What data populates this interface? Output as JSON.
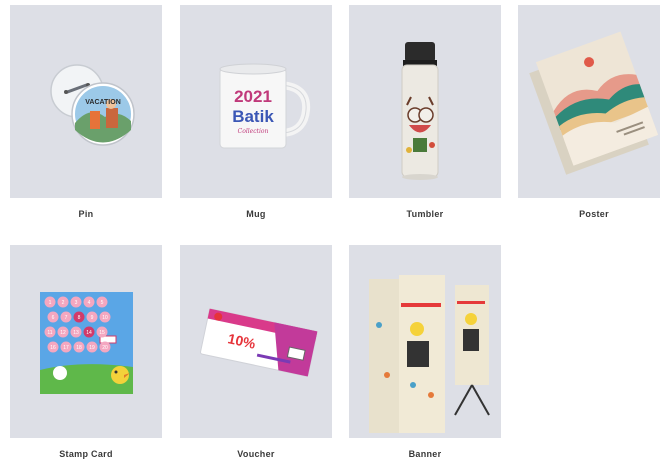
{
  "products": [
    {
      "label": "Pin",
      "icon": "pin-badge-illustration",
      "badge_text": "VACATION"
    },
    {
      "label": "Mug",
      "icon": "mug-illustration",
      "print_line1": "2021",
      "print_line2": "Batik",
      "print_line3": "Collection"
    },
    {
      "label": "Tumbler",
      "icon": "tumbler-illustration"
    },
    {
      "label": "Poster",
      "icon": "poster-illustration"
    },
    {
      "label": "Stamp Card",
      "icon": "stamp-card-illustration",
      "numbers": [
        "1",
        "2",
        "3",
        "4",
        "5",
        "6",
        "7",
        "8",
        "9",
        "10",
        "11",
        "12",
        "13",
        "14",
        "15",
        "16",
        "17",
        "18",
        "19",
        "20"
      ]
    },
    {
      "label": "Voucher",
      "icon": "voucher-illustration",
      "big_text": "10%"
    },
    {
      "label": "Banner",
      "icon": "banner-illustration"
    }
  ]
}
